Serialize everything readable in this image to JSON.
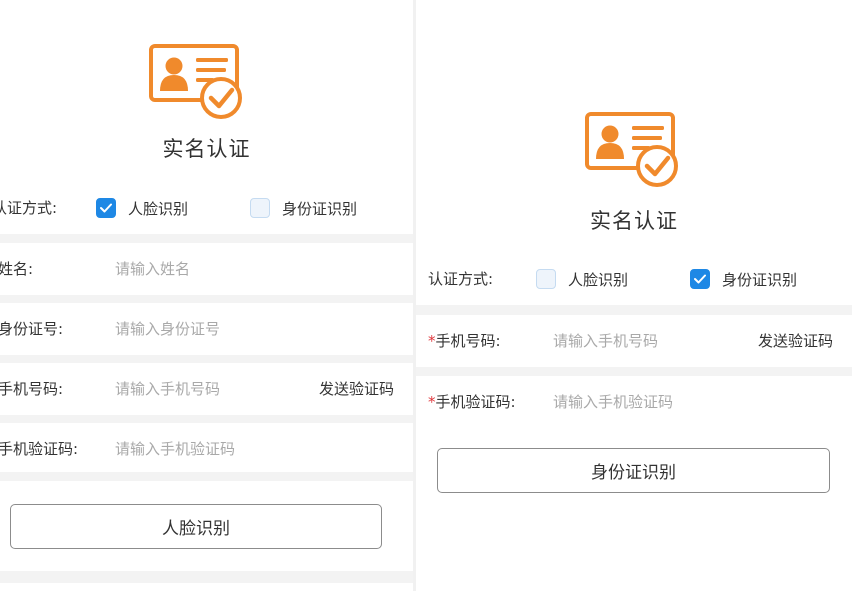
{
  "colors": {
    "accent_orange": "#f08a2c",
    "checkbox_blue": "#1e88e5",
    "required_star": "#e0393e",
    "placeholder": "#a9a9a9",
    "separator": "#f3f3f3"
  },
  "left": {
    "logo_icon": "id-card-verified-icon",
    "title": "实名认证",
    "method": {
      "label": "认证方式:",
      "options": [
        {
          "label": "人脸识别",
          "checked": true
        },
        {
          "label": "身份证识别",
          "checked": false
        }
      ]
    },
    "name_field": {
      "label": "姓名:",
      "placeholder": "请输入姓名"
    },
    "idnum_field": {
      "label": "身份证号:",
      "placeholder": "请输入身份证号"
    },
    "phone_field": {
      "label": "手机号码:",
      "placeholder": "请输入手机号码",
      "action": "发送验证码"
    },
    "code_field": {
      "label": "手机验证码:",
      "placeholder": "请输入手机验证码"
    },
    "submit_label": "人脸识别"
  },
  "right": {
    "logo_icon": "id-card-verified-icon",
    "title": "实名认证",
    "method": {
      "label": "认证方式:",
      "options": [
        {
          "label": "人脸识别",
          "checked": false
        },
        {
          "label": "身份证识别",
          "checked": true
        }
      ]
    },
    "phone_field": {
      "required_mark": "*",
      "label": "手机号码:",
      "placeholder": "请输入手机号码",
      "action": "发送验证码"
    },
    "code_field": {
      "required_mark": "*",
      "label": "手机验证码:",
      "placeholder": "请输入手机验证码"
    },
    "submit_label": "身份证识别"
  }
}
